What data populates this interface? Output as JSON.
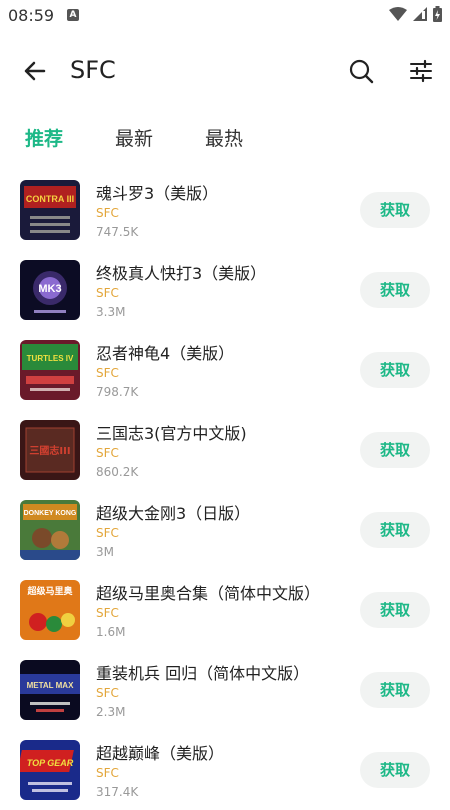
{
  "status_bar": {
    "time": "08:59",
    "notification_letter": "A"
  },
  "header": {
    "title": "SFC"
  },
  "tabs": [
    {
      "label": "推荐",
      "active": true
    },
    {
      "label": "最新",
      "active": false
    },
    {
      "label": "最热",
      "active": false
    }
  ],
  "colors": {
    "accent": "#1db887",
    "platform": "#e3a63a"
  },
  "games": [
    {
      "name": "魂斗罗3（美版）",
      "platform": "SFC",
      "size": "747.5K",
      "action": "获取",
      "thumb_icon": "contra-3-cover",
      "thumb_text": "CONTRA III"
    },
    {
      "name": "终极真人快打3（美版）",
      "platform": "SFC",
      "size": "3.3M",
      "action": "获取",
      "thumb_icon": "mortal-kombat-3-cover",
      "thumb_text": "MK3"
    },
    {
      "name": "忍者神龟4（美版）",
      "platform": "SFC",
      "size": "798.7K",
      "action": "获取",
      "thumb_icon": "tmnt-4-cover",
      "thumb_text": "TURTLES IV"
    },
    {
      "name": "三国志3(官方中文版)",
      "platform": "SFC",
      "size": "860.2K",
      "action": "获取",
      "thumb_icon": "sangokushi-3-cover",
      "thumb_text": "三國志III"
    },
    {
      "name": "超级大金刚3（日版）",
      "platform": "SFC",
      "size": "3M",
      "action": "获取",
      "thumb_icon": "donkey-kong-3-cover",
      "thumb_text": "DONKEY KONG"
    },
    {
      "name": "超级马里奥合集（简体中文版）",
      "platform": "SFC",
      "size": "1.6M",
      "action": "获取",
      "thumb_icon": "super-mario-collection-cover",
      "thumb_text": "超级马里奥"
    },
    {
      "name": "重装机兵 回归（简体中文版）",
      "platform": "SFC",
      "size": "2.3M",
      "action": "获取",
      "thumb_icon": "metal-max-returns-cover",
      "thumb_text": "METAL MAX"
    },
    {
      "name": "超越巅峰（美版）",
      "platform": "SFC",
      "size": "317.4K",
      "action": "获取",
      "thumb_icon": "top-gear-cover",
      "thumb_text": "TOP GEAR"
    }
  ]
}
